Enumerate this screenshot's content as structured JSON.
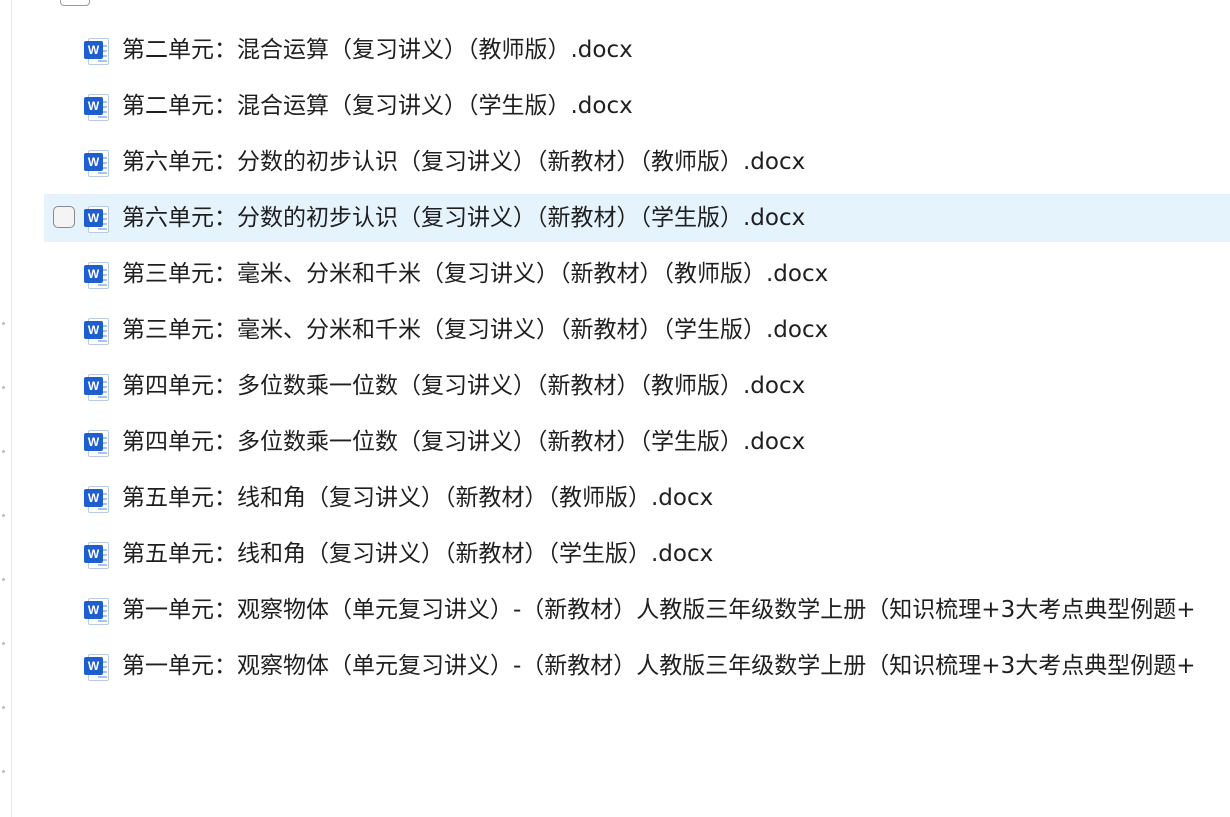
{
  "file_icon": {
    "name": "word-docx-icon",
    "badge_letter": "W",
    "badge_color": "#1d5fd1"
  },
  "colors": {
    "selected_row_bg": "#e5f3fd",
    "text": "#1f1f1f"
  },
  "files": [
    {
      "name": "第二单元：混合运算（复习讲义）（教师版）.docx",
      "selected": false
    },
    {
      "name": "第二单元：混合运算（复习讲义）（学生版）.docx",
      "selected": false
    },
    {
      "name": "第六单元：分数的初步认识（复习讲义）（新教材）（教师版）.docx",
      "selected": false
    },
    {
      "name": "第六单元：分数的初步认识（复习讲义）（新教材）（学生版）.docx",
      "selected": true
    },
    {
      "name": "第三单元：毫米、分米和千米（复习讲义）（新教材）（教师版）.docx",
      "selected": false
    },
    {
      "name": "第三单元：毫米、分米和千米（复习讲义）（新教材）（学生版）.docx",
      "selected": false
    },
    {
      "name": "第四单元：多位数乘一位数（复习讲义）（新教材）（教师版）.docx",
      "selected": false
    },
    {
      "name": "第四单元：多位数乘一位数（复习讲义）（新教材）（学生版）.docx",
      "selected": false
    },
    {
      "name": "第五单元：线和角（复习讲义）（新教材）（教师版）.docx",
      "selected": false
    },
    {
      "name": "第五单元：线和角（复习讲义）（新教材）（学生版）.docx",
      "selected": false
    },
    {
      "name": "第一单元：观察物体（单元复习讲义）-（新教材）人教版三年级数学上册（知识梳理+3大考点典型例题+",
      "selected": false
    },
    {
      "name": "第一单元：观察物体（单元复习讲义）-（新教材）人教版三年级数学上册（知识梳理+3大考点典型例题+",
      "selected": false
    }
  ]
}
